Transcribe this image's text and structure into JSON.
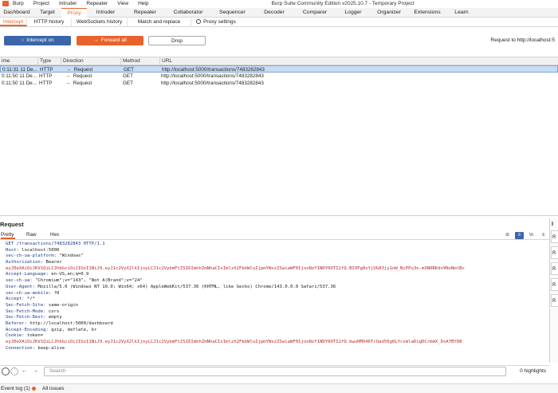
{
  "menu": {
    "items": [
      "Burp",
      "Project",
      "Intruder",
      "Repeater",
      "View",
      "Help"
    ]
  },
  "app_title": "Burp Suite Community Edition v2025.10.7 - Temporary Project",
  "main_tabs": [
    "Dashboard",
    "Target",
    "Proxy",
    "Intruder",
    "Repeater",
    "Collaborator",
    "Sequencer",
    "Decoder",
    "Comparer",
    "Logger",
    "Organizer",
    "Extensions",
    "Learn"
  ],
  "main_tab_active": "Proxy",
  "sub_tabs": [
    "Intercept",
    "HTTP history",
    "WebSockets history",
    "Match and replace",
    "Proxy settings"
  ],
  "toolbar": {
    "intercept_label": "Intercept on",
    "forward_label": "Forward all",
    "drop_label": "Drop",
    "request_to": "Request to http://localhost:5"
  },
  "table": {
    "headers": [
      "ime",
      "Type",
      "Direction",
      "Method",
      "URL"
    ],
    "rows": [
      {
        "time": "0:11:31 11 De...",
        "type": "HTTP",
        "direction": "Request",
        "method": "GET",
        "url": "http://localhost:5000/transactions/7483282843"
      },
      {
        "time": "0:11:50 11 De...",
        "type": "HTTP",
        "direction": "Request",
        "method": "GET",
        "url": "http://localhost:5000/transactions/7483282843"
      },
      {
        "time": "0:11:50 11 De...",
        "type": "HTTP",
        "direction": "Request",
        "method": "GET",
        "url": "http://localhost:5000/transactions/7483282843"
      }
    ]
  },
  "request": {
    "title": "Request",
    "view_tabs": [
      "Pretty",
      "Raw",
      "Hex"
    ],
    "view_icon_n": "\\n",
    "view_icon_ln": "ln",
    "lines": [
      {
        "key": "GET /transactions/7483282843 HTTP/1.1",
        "value": "",
        "red": false
      },
      {
        "key": "Host:",
        "value": " localhost:5000",
        "red": false
      },
      {
        "key": "sec-ch-ua-platform:",
        "value": " \"Windows\"",
        "red": false
      },
      {
        "key": "Authorization:",
        "value": " Bearer",
        "red": false
      },
      {
        "key": "",
        "value": "eyJ0eXAiOiJKV1QiLCJhbGciOiJIUzI1NiJ9.eyJ1c2VyX2lkIjoyLCJ1c2VybmFtZSI6ImhhZmNhaCIsImlzX2FkbWluIjpmYWxzZSwiaWF0IjoxNzY1NDY0OTI2fQ.BI9Fg8sYjUG83jy1nW_NcPPu3n-mXN0RKds¥NzNmlBc",
        "red": true
      },
      {
        "key": "Accept-Language:",
        "value": " en-US,en;q=0.9",
        "red": false
      },
      {
        "key": "sec-ch-ua:",
        "value": " \"Chromium\";v=\"143\", \"Not A(Brand\";v=\"24\"",
        "red": false
      },
      {
        "key": "User-Agent:",
        "value": " Mozilla/5.0 (Windows NT 10.0; Win64; x64) AppleWebKit/537.36 (KHTML, like Gecko) Chrome/143.0.0.0 Safari/537.36",
        "red": false
      },
      {
        "key": "sec-ch-ua-mobile:",
        "value": " ?0",
        "red": false
      },
      {
        "key": "Accept:",
        "value": " */*",
        "red": false
      },
      {
        "key": "Sec-Fetch-Site:",
        "value": " same-origin",
        "red": false
      },
      {
        "key": "Sec-Fetch-Mode:",
        "value": " cors",
        "red": false
      },
      {
        "key": "Sec-Fetch-Dest:",
        "value": " empty",
        "red": false
      },
      {
        "key": "Referer:",
        "value": " http://localhost:5000/dashboard",
        "red": false
      },
      {
        "key": "Accept-Encoding:",
        "value": " gzip, deflate, br",
        "red": false
      },
      {
        "key": "Cookie:",
        "value": " token=",
        "red": false
      },
      {
        "key": "",
        "value": "eyJ0eXAiOiJKV1QiLCJhbGciOiJIUzI1NiJ9.eyJ1c2VyX2lkIjoyLCJ1c2VybmFtZSI6ImhhZmNhaCIsImlzX2FkbWluIjpmYWxzZSwiaWF0IjoxNzY1NDY0OTI2fQ.bwuHMX46TrQad56g0LYcsmlaDigDCrmmX_DsA7BY08",
        "red": true
      },
      {
        "key": "Connection:",
        "value": " keep-alive",
        "red": false
      }
    ]
  },
  "inspector": {
    "title": "I",
    "rows": [
      "R",
      "R",
      "R",
      "R",
      "R"
    ]
  },
  "search": {
    "placeholder": "Search",
    "highlights": "0 highlights"
  },
  "status": {
    "event_log": "Event log (1)",
    "all_issues": "All issues"
  },
  "colors": {
    "accent": "#e8632b",
    "primary": "#3b66a8",
    "selection": "#c9dcf3"
  }
}
